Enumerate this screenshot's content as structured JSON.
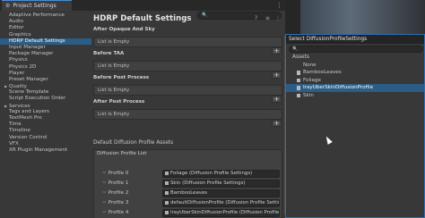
{
  "project_settings": {
    "tab_title": "Project Settings",
    "menu_icon": "more-vertical-icon",
    "sidebar": [
      {
        "label": "Adaptive Performance",
        "caret": false,
        "selected": false
      },
      {
        "label": "Audio",
        "caret": false,
        "selected": false
      },
      {
        "label": "Editor",
        "caret": false,
        "selected": false
      },
      {
        "label": "Graphics",
        "caret": false,
        "selected": false
      },
      {
        "label": "HDRP Default Settings",
        "caret": false,
        "selected": true
      },
      {
        "label": "Input Manager",
        "caret": false,
        "selected": false
      },
      {
        "label": "Package Manager",
        "caret": false,
        "selected": false
      },
      {
        "label": "Physics",
        "caret": false,
        "selected": false
      },
      {
        "label": "Physics 2D",
        "caret": false,
        "selected": false
      },
      {
        "label": "Player",
        "caret": false,
        "selected": false
      },
      {
        "label": "Preset Manager",
        "caret": false,
        "selected": false
      },
      {
        "label": "Quality",
        "caret": true,
        "selected": false
      },
      {
        "label": "Scene Template",
        "caret": false,
        "selected": false
      },
      {
        "label": "Script Execution Order",
        "caret": false,
        "selected": false
      },
      {
        "label": "Services",
        "caret": true,
        "selected": false
      },
      {
        "label": "Tags and Layers",
        "caret": false,
        "selected": false
      },
      {
        "label": "TextMesh Pro",
        "caret": false,
        "selected": false
      },
      {
        "label": "Time",
        "caret": false,
        "selected": false
      },
      {
        "label": "Timeline",
        "caret": false,
        "selected": false
      },
      {
        "label": "Version Control",
        "caret": false,
        "selected": false
      },
      {
        "label": "VFX",
        "caret": false,
        "selected": false
      },
      {
        "label": "XR Plugin Management",
        "caret": false,
        "selected": false
      }
    ],
    "main": {
      "title": "HDRP Default Settings",
      "sections": [
        {
          "label": "After Opaque And Sky",
          "list_text": "List is Empty",
          "add_label": "+"
        },
        {
          "label": "Before TAA",
          "list_text": "List is Empty",
          "add_label": "+"
        },
        {
          "label": "Before Post Process",
          "list_text": "List is Empty",
          "add_label": "+"
        },
        {
          "label": "After Post Process",
          "list_text": "List is Empty",
          "add_label": "+"
        }
      ],
      "diffusion_header": "Default Diffusion Profile Assets",
      "diffusion_list_label": "Diffusion Profile List",
      "profiles": [
        {
          "label": "Profile 0",
          "value": "Foliage (Diffusion Profile Settings)"
        },
        {
          "label": "Profile 1",
          "value": "Skin (Diffusion Profile Settings)"
        },
        {
          "label": "Profile 2",
          "value": "BambooLeaves"
        },
        {
          "label": "Profile 3",
          "value": "defaultDiffusionProfile (Diffusion Profile Settings)"
        },
        {
          "label": "Profile 4",
          "value": "IrayUberSkinDiffusionProfile (Diffusion Profile Settings)"
        }
      ]
    }
  },
  "select_window": {
    "title": "Select DiffusionProfileSettings",
    "assets_label": "Assets",
    "items": [
      {
        "label": "None",
        "icon": false,
        "selected": false
      },
      {
        "label": "BambooLeaves",
        "icon": true,
        "selected": false
      },
      {
        "label": "Foliage",
        "icon": true,
        "selected": false
      },
      {
        "label": "IrayUberSkinDiffusionProfile",
        "icon": true,
        "selected": true
      },
      {
        "label": "Skin",
        "icon": true,
        "selected": false
      }
    ]
  }
}
